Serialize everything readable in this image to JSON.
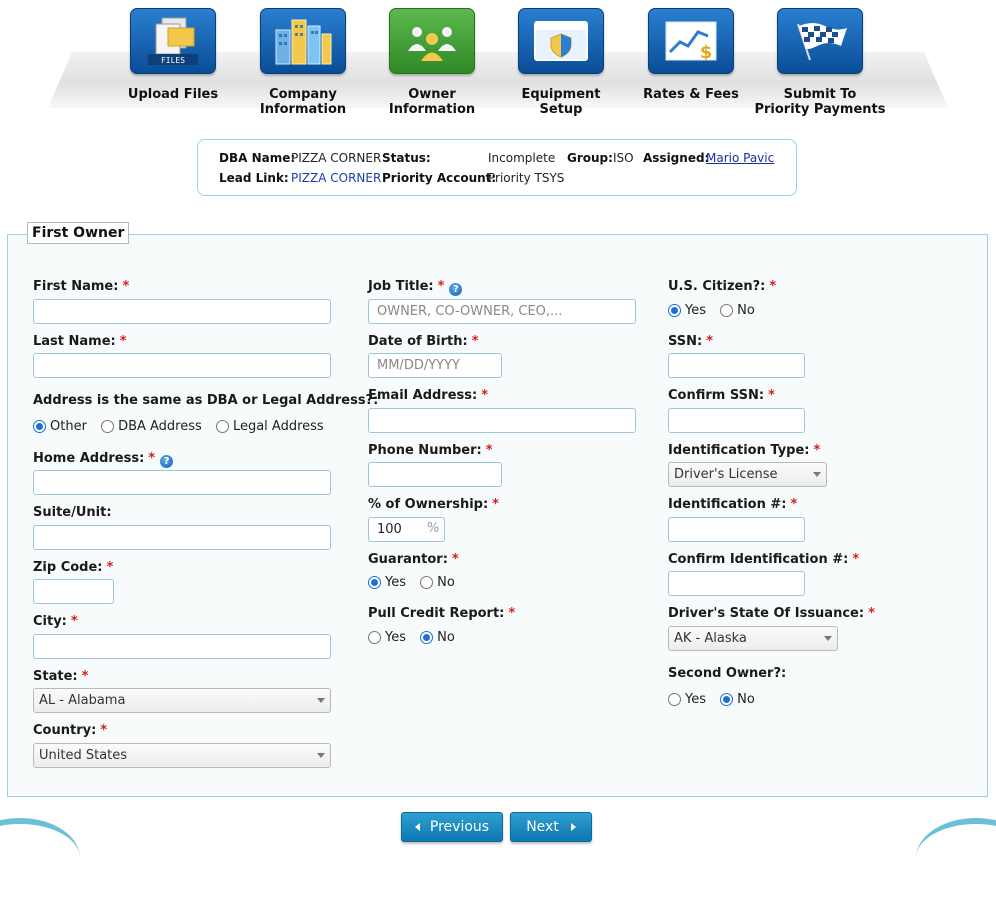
{
  "wizard": {
    "steps": [
      {
        "label": "Upload Files",
        "icon": "files-icon",
        "badge": "FILES"
      },
      {
        "label": "Company\nInformation",
        "icon": "buildings-icon"
      },
      {
        "label": "Owner\nInformation",
        "icon": "owners-icon",
        "active": true
      },
      {
        "label": "Equipment\nSetup",
        "icon": "browser-shield-icon"
      },
      {
        "label": "Rates & Fees",
        "icon": "chart-dollar-icon"
      },
      {
        "label": "Submit To\nPriority Payments",
        "icon": "checkered-flag-icon"
      }
    ]
  },
  "info": {
    "dba_name_label": "DBA Name:",
    "dba_name": "PIZZA CORNER",
    "status_label": "Status:",
    "status": "Incomplete",
    "group_label": "Group:",
    "group": "ISO",
    "assigned_label": "Assigned:",
    "assigned": "Mario Pavic",
    "lead_link_label": "Lead Link:",
    "lead_link": "PIZZA CORNER",
    "priority_account_label": "Priority Account:",
    "priority_account": "Priority TSYS"
  },
  "form": {
    "legend": "First Owner",
    "required_mark": "*",
    "help_mark": "?",
    "first_name": {
      "label": "First Name:",
      "value": ""
    },
    "last_name": {
      "label": "Last Name:",
      "value": ""
    },
    "address_same": {
      "label": "Address is the same as DBA or Legal Address?:",
      "options": [
        "Other",
        "DBA Address",
        "Legal Address"
      ],
      "selected": "Other"
    },
    "home_address": {
      "label": "Home Address:",
      "value": ""
    },
    "suite": {
      "label": "Suite/Unit:",
      "value": ""
    },
    "zip": {
      "label": "Zip Code:",
      "value": ""
    },
    "city": {
      "label": "City:",
      "value": ""
    },
    "state": {
      "label": "State:",
      "value": "AL - Alabama"
    },
    "country": {
      "label": "Country:",
      "value": "United States"
    },
    "job_title": {
      "label": "Job Title:",
      "placeholder": "OWNER, CO-OWNER, CEO,..."
    },
    "dob": {
      "label": "Date of Birth:",
      "placeholder": "MM/DD/YYYY"
    },
    "email": {
      "label": "Email Address:",
      "value": ""
    },
    "phone": {
      "label": "Phone Number:",
      "value": ""
    },
    "ownership": {
      "label": "% of Ownership:",
      "value": "100",
      "suffix": "%"
    },
    "guarantor": {
      "label": "Guarantor:",
      "options": [
        "Yes",
        "No"
      ],
      "selected": "Yes"
    },
    "pull_credit": {
      "label": "Pull Credit Report:",
      "options": [
        "Yes",
        "No"
      ],
      "selected": "No"
    },
    "us_citizen": {
      "label": "U.S. Citizen?:",
      "options": [
        "Yes",
        "No"
      ],
      "selected": "Yes"
    },
    "ssn": {
      "label": "SSN:",
      "value": ""
    },
    "confirm_ssn": {
      "label": "Confirm SSN:",
      "value": ""
    },
    "id_type": {
      "label": "Identification Type:",
      "value": "Driver's License"
    },
    "id_number": {
      "label": "Identification #:",
      "value": ""
    },
    "confirm_id": {
      "label": "Confirm Identification #:",
      "value": ""
    },
    "dl_state": {
      "label": "Driver's State Of Issuance:",
      "value": "AK - Alaska"
    },
    "second_owner": {
      "label": "Second Owner?:",
      "options": [
        "Yes",
        "No"
      ],
      "selected": "No"
    }
  },
  "nav": {
    "previous": "Previous",
    "next": "Next"
  },
  "colors": {
    "accent_blue": "#0c77b2",
    "active_step_green": "#2f8a27",
    "required_red": "#d21f1f"
  }
}
